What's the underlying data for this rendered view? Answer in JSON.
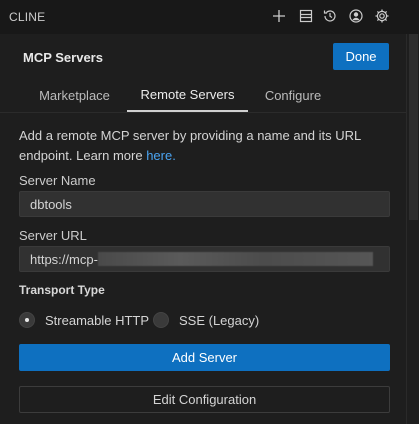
{
  "app": {
    "title": "CLINE",
    "toolbar_icons": [
      "plus-icon",
      "history-list-icon",
      "history-icon",
      "account-icon",
      "gear-icon"
    ]
  },
  "header": {
    "title": "MCP Servers",
    "done_label": "Done"
  },
  "tabs": [
    {
      "label": "Marketplace",
      "active": false
    },
    {
      "label": "Remote Servers",
      "active": true
    },
    {
      "label": "Configure",
      "active": false
    }
  ],
  "form": {
    "description": "Add a remote MCP server by providing a name and its URL endpoint. Learn more ",
    "learn_more_link": "here.",
    "server_name_label": "Server Name",
    "server_name_value": "dbtools",
    "server_url_label": "Server URL",
    "server_url_value": "https://mcp-",
    "transport_label": "Transport Type",
    "transport_options": [
      {
        "label": "Streamable HTTP",
        "selected": true
      },
      {
        "label": "SSE (Legacy)",
        "selected": false
      }
    ],
    "add_server_label": "Add Server",
    "edit_config_label": "Edit Configuration"
  },
  "colors": {
    "accent": "#0e70c0",
    "link": "#4aa3f0",
    "background": "#1e1e1e"
  }
}
